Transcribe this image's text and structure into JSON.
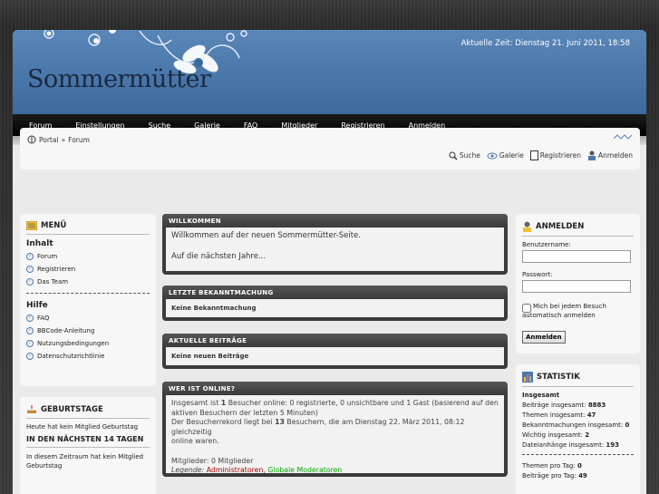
{
  "header": {
    "site_title": "Sommermütter",
    "clock": "Aktuelle Zeit: Dienstag 21. Juni 2011, 18:58"
  },
  "nav": [
    "Forum",
    "Einstellungen",
    "Suche",
    "Galerie",
    "FAQ",
    "Mitglieder",
    "Registrieren",
    "Anmelden"
  ],
  "breadcrumb": {
    "portal": "Portal",
    "sep": "»",
    "forum": "Forum"
  },
  "quicklinks": [
    "Suche",
    "Galerie",
    "Registrieren",
    "Anmelden"
  ],
  "menu": {
    "title": "MENÜ",
    "inhalt_heading": "Inhalt",
    "inhalt_items": [
      "Forum",
      "Registrieren",
      "Das Team"
    ],
    "hilfe_heading": "Hilfe",
    "hilfe_items": [
      "FAQ",
      "BBCode-Anleitung",
      "Nutzungsbedingungen",
      "Datenschutzrichtlinie"
    ]
  },
  "birthdays": {
    "title": "GEBURTSTAGE",
    "today": "Heute hat kein Mitglied Geburtstag",
    "next_heading": "IN DEN NÄCHSTEN 14 TAGEN",
    "next_text": "In diesem Zeitraum hat kein Mitglied Geburtstag"
  },
  "welcome": {
    "title": "WILLKOMMEN",
    "line1": "Willkommen auf der neuen Sommermütter-Seite.",
    "line2": "Auf die nächsten Jahre..."
  },
  "announcement": {
    "title": "LETZTE BEKANNTMACHUNG",
    "text": "Keine Bekanntmachung"
  },
  "recent_posts": {
    "title": "AKTUELLE BEITRÄGE",
    "text": "Keine neuen Beiträge"
  },
  "online": {
    "title": "WER IST ONLINE?",
    "line1_pre": "Insgesamt ist ",
    "line1_count": "1",
    "line1_post": " Besucher online: 0 registrierte, 0 unsichtbare und 1 Gast (basierend auf den Besuchern der letzten 5 Minuten)",
    "line1_wrap": "aktiven Besuchern der letzten 5 Minuten)",
    "line2_pre": "Der Besucherrekord liegt bei ",
    "line2_count": "13",
    "line2_post": " Besuchern, die am Dienstag 22. März 2011, 08:12 gleichzeitig",
    "line2_wrap": "online waren.",
    "members": "Mitglieder: 0 Mitglieder",
    "legend_label": "Legende:",
    "legend_admin": "Administratoren",
    "legend_sep": ", ",
    "legend_mod": "Globale Moderatoren",
    "admin_color": "#aa0000",
    "mod_color": "#00aa00"
  },
  "login": {
    "title": "ANMELDEN",
    "user_label": "Benutzername:",
    "pass_label": "Passwort:",
    "remember_line1": "Mich bei jedem Besuch",
    "remember_line2": "automatisch anmelden",
    "button": "Anmelden"
  },
  "stats": {
    "title": "STATISTIK",
    "heading": "Insgesamt",
    "items": [
      {
        "label": "Beiträge insgesamt:",
        "value": "8883"
      },
      {
        "label": "Themen insgesamt:",
        "value": "47"
      },
      {
        "label": "Bekanntmachungen insgesamt:",
        "value": "0"
      },
      {
        "label": "Wichtig insgesamt:",
        "value": "2"
      },
      {
        "label": "Dateianhänge insgesamt:",
        "value": "193"
      }
    ],
    "per_day": [
      {
        "label": "Themen pro Tag:",
        "value": "0"
      },
      {
        "label": "Beiträge pro Tag:",
        "value": "49"
      }
    ]
  }
}
